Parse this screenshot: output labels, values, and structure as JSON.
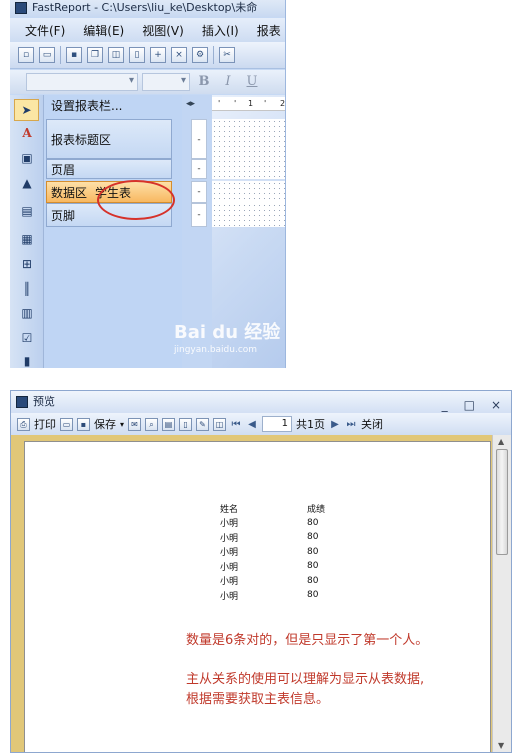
{
  "designer": {
    "title": "FastReport - C:\\Users\\liu_ke\\Desktop\\未命",
    "menu": [
      "文件(F)",
      "编辑(E)",
      "视图(V)",
      "插入(I)",
      "报表"
    ],
    "toolbar_icons": [
      "new-icon",
      "open-icon",
      "save-icon",
      "copy-icon",
      "preview-icon",
      "page-icon",
      "page-add-icon",
      "delete-icon",
      "settings-icon",
      "cut-icon"
    ],
    "format_buttons": [
      "B",
      "I",
      "U"
    ],
    "left_tools": [
      "pointer-icon",
      "text-icon",
      "picture-icon",
      "shapes-icon",
      "subreport-icon",
      "table-icon",
      "crosstab-icon",
      "barcode-icon",
      "richtext-icon",
      "checkbox-icon",
      "chart-icon"
    ],
    "band_header": "设置报表栏...",
    "bands": {
      "report_title": "报表标题区",
      "page_header": "页眉",
      "data_band": "数据区",
      "data_source": "学生表",
      "page_footer": "页脚"
    },
    "ruler_digits": [
      "1",
      "2"
    ],
    "watermark": {
      "logo": "Bai du 经验",
      "url": "jingyan.baidu.com"
    }
  },
  "preview": {
    "title": "预览",
    "window_buttons": [
      "_",
      "□",
      "×"
    ],
    "toolbar": {
      "print": "打印",
      "save": "保存",
      "page_number": "1",
      "page_total": "共1页",
      "close": "关闭"
    },
    "report": {
      "headers": [
        "姓名",
        "成绩"
      ],
      "rows": [
        [
          "小明",
          "80"
        ],
        [
          "小明",
          "80"
        ],
        [
          "小明",
          "80"
        ],
        [
          "小明",
          "80"
        ],
        [
          "小明",
          "80"
        ],
        [
          "小明",
          "80"
        ]
      ]
    },
    "annotation_1": "数量是6条对的，但是只显示了第一个人。",
    "annotation_2": "主从关系的使用可以理解为显示从表数据,",
    "annotation_3": "根据需要获取主表信息。"
  }
}
